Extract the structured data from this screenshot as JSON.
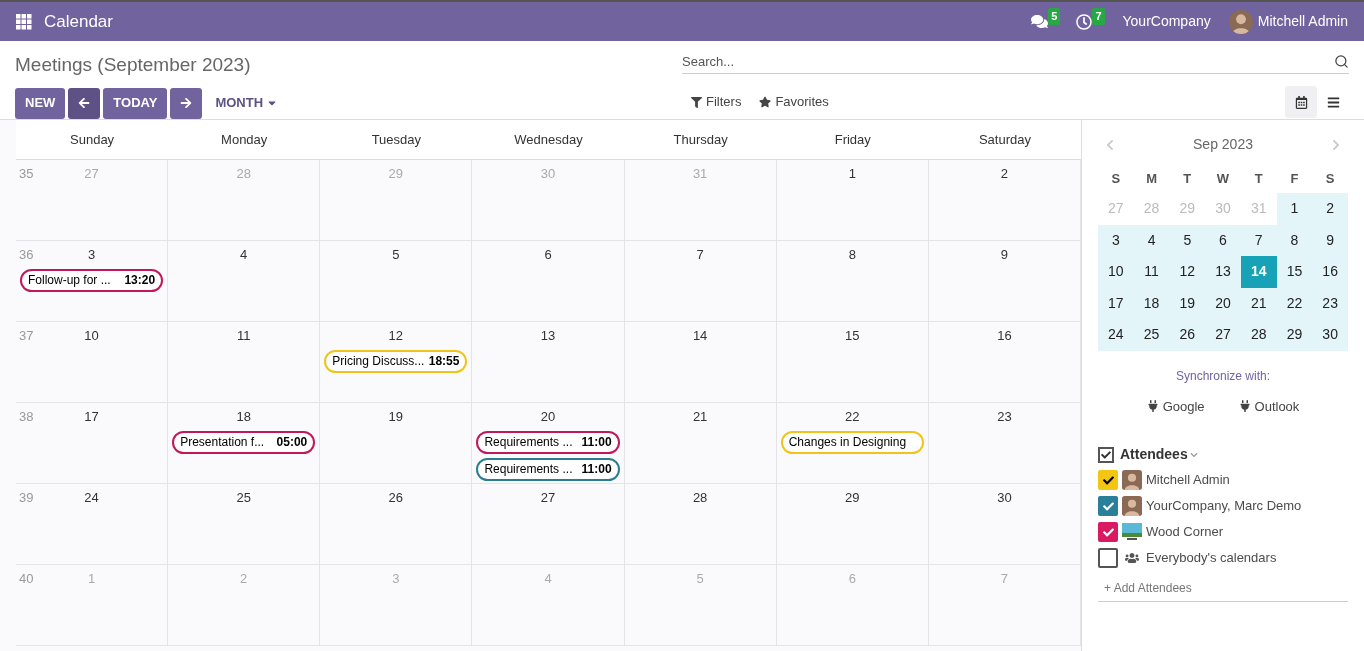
{
  "topbar": {
    "app_title": "Calendar",
    "messages_badge": "5",
    "activities_badge": "7",
    "company": "YourCompany",
    "user": "Mitchell Admin"
  },
  "page": {
    "title": "Meetings (September 2023)",
    "buttons": {
      "new": "NEW",
      "today": "TODAY"
    },
    "scale": "MONTH",
    "search": {
      "placeholder": "Search..."
    },
    "filters": "Filters",
    "favorites": "Favorites",
    "views": [
      {
        "kind": "calendar",
        "selected": true
      },
      {
        "kind": "list",
        "selected": false
      }
    ]
  },
  "calendar": {
    "weekdays": [
      "Sunday",
      "Monday",
      "Tuesday",
      "Wednesday",
      "Thursday",
      "Friday",
      "Saturday"
    ],
    "weeks": [
      {
        "number": "35",
        "days": [
          {
            "label": "27",
            "muted": true
          },
          {
            "label": "28",
            "muted": true
          },
          {
            "label": "29",
            "muted": true
          },
          {
            "label": "30",
            "muted": true
          },
          {
            "label": "31",
            "muted": true
          },
          {
            "label": "1",
            "muted": false
          },
          {
            "label": "2",
            "muted": false
          }
        ]
      },
      {
        "number": "36",
        "days": [
          {
            "label": "3",
            "muted": false,
            "events": [
              {
                "title": "Follow-up for ...",
                "time": "13:20",
                "color": "#c2185b"
              }
            ]
          },
          {
            "label": "4",
            "muted": false
          },
          {
            "label": "5",
            "muted": false
          },
          {
            "label": "6",
            "muted": false
          },
          {
            "label": "7",
            "muted": false
          },
          {
            "label": "8",
            "muted": false
          },
          {
            "label": "9",
            "muted": false
          }
        ]
      },
      {
        "number": "37",
        "days": [
          {
            "label": "10",
            "muted": false
          },
          {
            "label": "11",
            "muted": false
          },
          {
            "label": "12",
            "muted": false,
            "events": [
              {
                "title": "Pricing Discuss...",
                "time": "18:55",
                "color": "#f0c419"
              }
            ]
          },
          {
            "label": "13",
            "muted": false
          },
          {
            "label": "14",
            "muted": false
          },
          {
            "label": "15",
            "muted": false
          },
          {
            "label": "16",
            "muted": false
          }
        ]
      },
      {
        "number": "38",
        "days": [
          {
            "label": "17",
            "muted": false
          },
          {
            "label": "18",
            "muted": false,
            "events": [
              {
                "title": "Presentation f...",
                "time": "05:00",
                "color": "#c2185b"
              }
            ]
          },
          {
            "label": "19",
            "muted": false
          },
          {
            "label": "20",
            "muted": false,
            "events": [
              {
                "title": "Requirements ...",
                "time": "11:00",
                "color": "#c2185b"
              },
              {
                "title": "Requirements ...",
                "time": "11:00",
                "color": "#2a7f8f"
              }
            ]
          },
          {
            "label": "21",
            "muted": false
          },
          {
            "label": "22",
            "muted": false,
            "events": [
              {
                "title": "Changes in Designing",
                "color": "#f0c419"
              }
            ]
          },
          {
            "label": "23",
            "muted": false
          }
        ]
      },
      {
        "number": "39",
        "days": [
          {
            "label": "24",
            "muted": false
          },
          {
            "label": "25",
            "muted": false
          },
          {
            "label": "26",
            "muted": false
          },
          {
            "label": "27",
            "muted": false
          },
          {
            "label": "28",
            "muted": false
          },
          {
            "label": "29",
            "muted": false
          },
          {
            "label": "30",
            "muted": false
          }
        ]
      },
      {
        "number": "40",
        "days": [
          {
            "label": "1",
            "muted": true
          },
          {
            "label": "2",
            "muted": true
          },
          {
            "label": "3",
            "muted": true
          },
          {
            "label": "4",
            "muted": true
          },
          {
            "label": "5",
            "muted": true
          },
          {
            "label": "6",
            "muted": true
          },
          {
            "label": "7",
            "muted": true
          }
        ]
      }
    ]
  },
  "sidebar": {
    "mini_calendar": {
      "month": "Sep 2023",
      "weekdays": [
        "S",
        "M",
        "T",
        "W",
        "T",
        "F",
        "S"
      ],
      "days": [
        {
          "label": "27",
          "muted": true,
          "selected": false
        },
        {
          "label": "28",
          "muted": true,
          "selected": false
        },
        {
          "label": "29",
          "muted": true,
          "selected": false
        },
        {
          "label": "30",
          "muted": true,
          "selected": false
        },
        {
          "label": "31",
          "muted": true,
          "selected": false
        },
        {
          "label": "1",
          "muted": false,
          "selected": false
        },
        {
          "label": "2",
          "muted": false,
          "selected": false
        },
        {
          "label": "3",
          "muted": false,
          "selected": false
        },
        {
          "label": "4",
          "muted": false,
          "selected": false
        },
        {
          "label": "5",
          "muted": false,
          "selected": false
        },
        {
          "label": "6",
          "muted": false,
          "selected": false
        },
        {
          "label": "7",
          "muted": false,
          "selected": false
        },
        {
          "label": "8",
          "muted": false,
          "selected": false
        },
        {
          "label": "9",
          "muted": false,
          "selected": false
        },
        {
          "label": "10",
          "muted": false,
          "selected": false
        },
        {
          "label": "11",
          "muted": false,
          "selected": false
        },
        {
          "label": "12",
          "muted": false,
          "selected": false
        },
        {
          "label": "13",
          "muted": false,
          "selected": false
        },
        {
          "label": "14",
          "muted": false,
          "selected": true
        },
        {
          "label": "15",
          "muted": false,
          "selected": false
        },
        {
          "label": "16",
          "muted": false,
          "selected": false
        },
        {
          "label": "17",
          "muted": false,
          "selected": false
        },
        {
          "label": "18",
          "muted": false,
          "selected": false
        },
        {
          "label": "19",
          "muted": false,
          "selected": false
        },
        {
          "label": "20",
          "muted": false,
          "selected": false
        },
        {
          "label": "21",
          "muted": false,
          "selected": false
        },
        {
          "label": "22",
          "muted": false,
          "selected": false
        },
        {
          "label": "23",
          "muted": false,
          "selected": false
        },
        {
          "label": "24",
          "muted": false,
          "selected": false
        },
        {
          "label": "25",
          "muted": false,
          "selected": false
        },
        {
          "label": "26",
          "muted": false,
          "selected": false
        },
        {
          "label": "27",
          "muted": false,
          "selected": false
        },
        {
          "label": "28",
          "muted": false,
          "selected": false
        },
        {
          "label": "29",
          "muted": false,
          "selected": false
        },
        {
          "label": "30",
          "muted": false,
          "selected": false
        }
      ]
    },
    "sync": {
      "label": "Synchronize with:",
      "google": "Google",
      "outlook": "Outlook"
    },
    "attendees": {
      "title": "Attendees",
      "checked": true,
      "items": [
        {
          "name": "Mitchell Admin",
          "kind": "person",
          "checked": true,
          "color": "#f3c613"
        },
        {
          "name": "YourCompany, Marc Demo",
          "kind": "person",
          "checked": true,
          "color": "#2a8098"
        },
        {
          "name": "Wood Corner",
          "kind": "logo",
          "checked": true,
          "color": "#d81b60"
        },
        {
          "name": "Everybody's calendars",
          "kind": "group",
          "checked": false
        }
      ],
      "add": "+ Add Attendees"
    }
  }
}
